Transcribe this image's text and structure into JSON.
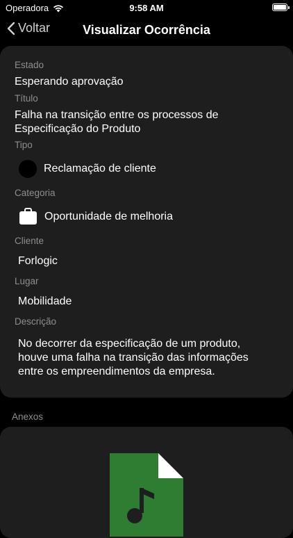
{
  "status_bar": {
    "carrier": "Operadora",
    "time": "9:58 AM"
  },
  "nav": {
    "back_label": "Voltar",
    "title": "Visualizar Ocorrência"
  },
  "details": {
    "state_label": "Estado",
    "state_value": "Esperando aprovação",
    "title_label": "Título",
    "title_line1": "Falha na transição entre os processos de",
    "title_line2": "Especificação do Produto",
    "type_label": "Tipo",
    "type_value": "Reclamação de cliente",
    "category_label": "Categoria",
    "category_value": "Oportunidade de melhoria",
    "client_label": "Cliente",
    "client_value": "Forlogic",
    "place_label": "Lugar",
    "place_value": "Mobilidade",
    "description_label": "Descrição",
    "description_line1": "No decorrer da especificação de um produto,",
    "description_line2": "houve uma falha na transição das informações",
    "description_line3": "entre os empreendimentos da empresa."
  },
  "attachments": {
    "label": "Anexos",
    "file_icon": "audio-file-icon",
    "file_icon_color": "#2e7d32"
  },
  "colors": {
    "background": "#000000",
    "card": "#1e1e1e",
    "label": "#8e8e93",
    "text": "#ffffff"
  }
}
